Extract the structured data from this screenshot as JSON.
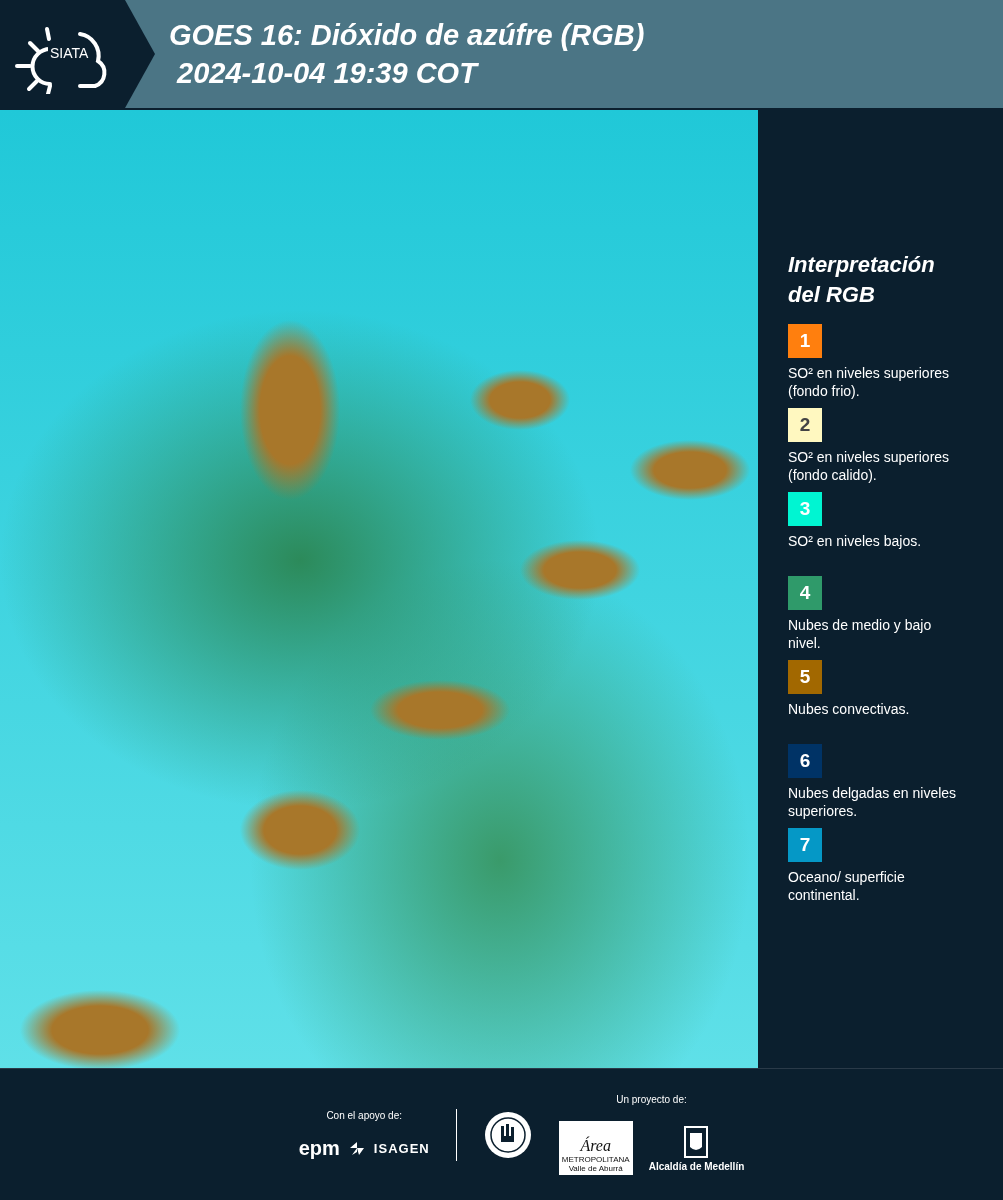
{
  "header": {
    "logo_text": "SIATA",
    "title": "GOES 16: Dióxido de azúfre (RGB)",
    "timestamp": "2024-10-04 19:39 COT"
  },
  "legend": {
    "title": "Interpretación del RGB",
    "items": [
      {
        "number": "1",
        "color": "#ff7f0e",
        "text": "SO² en niveles superiores (fondo frio)."
      },
      {
        "number": "2",
        "color": "#fff8c0",
        "text": "SO² en niveles superiores (fondo calido)."
      },
      {
        "number": "3",
        "color": "#00f5d2",
        "text": "SO² en niveles bajos."
      },
      {
        "number": "4",
        "color": "#2f9a6a",
        "text": "Nubes de medio y bajo nivel."
      },
      {
        "number": "5",
        "color": "#a26800",
        "text": "Nubes convectivas."
      },
      {
        "number": "6",
        "color": "#003366",
        "text": "Nubes delgadas en niveles superiores."
      },
      {
        "number": "7",
        "color": "#0598c6",
        "text": "Oceano/ superficie continental."
      }
    ]
  },
  "footer": {
    "support_label": "Con el apoyo de:",
    "project_label": "Un proyecto de:",
    "epm": "epm",
    "isagen": "ISAGEN",
    "area": "Área",
    "area_sub": "METROPOLITANA",
    "area_sub2": "Valle de Aburrá",
    "alcaldia": "Alcaldía de Medellín"
  }
}
